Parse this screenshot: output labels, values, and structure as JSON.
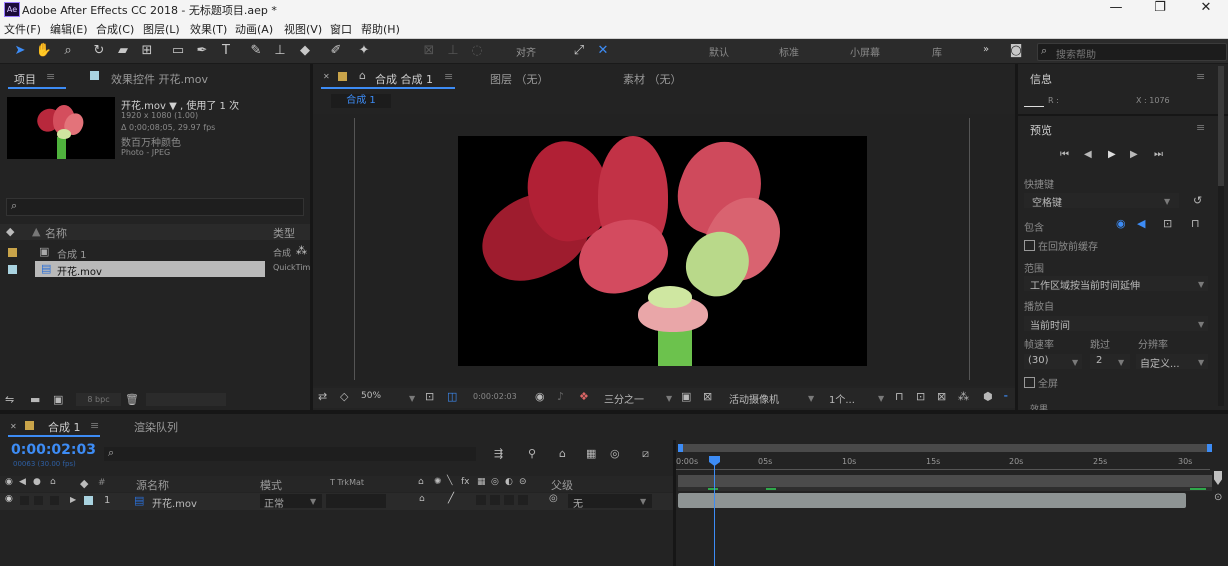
{
  "window": {
    "title": "Adobe After Effects CC 2018 - 无标题项目.aep *",
    "app_icon": "Ae",
    "minimize_icon": "—",
    "maximize_icon": "❐",
    "close_icon": "✕"
  },
  "menu": [
    "文件(F)",
    "编辑(E)",
    "合成(C)",
    "图层(L)",
    "效果(T)",
    "动画(A)",
    "视图(V)",
    "窗口",
    "帮助(H)"
  ],
  "toolbar": {
    "snap_label": "对齐",
    "workspaces": [
      "默认",
      "标准",
      "小屏幕",
      "库"
    ],
    "workspace_more": "»",
    "search_placeholder": "搜索帮助"
  },
  "project_panel": {
    "tab_project": "项目",
    "tab_effects": "效果控件 开花.mov",
    "selected_name": "开花.mov ▼ , 使用了 1 次",
    "info_line1": "1920 x 1080 (1.00)",
    "info_line2": "Δ 0;00;08;05, 29.97 fps",
    "info_line3": "数百万种颜色",
    "info_line4": "Photo - JPEG",
    "search_icon": "⌕",
    "col_name": "名称",
    "col_type": "类型",
    "items": [
      {
        "name": "合成 1",
        "type": "合成",
        "color": "#c9a44a"
      },
      {
        "name": "开花.mov",
        "type": "QuickTime",
        "color": "#a9d3e0"
      }
    ],
    "bpc": "8 bpc"
  },
  "composition_panel": {
    "tab_comp": "合成 合成 1",
    "tab_layer": "图层 （无）",
    "tab_footage": "素材 （无）",
    "breadcrumb": "合成 1",
    "zoom": "50%",
    "timecode": "0:00:02:03",
    "resolution": "三分之一",
    "camera": "活动摄像机",
    "views": "1个..."
  },
  "info_panel": {
    "title": "信息",
    "r_label": "R :",
    "x_label": "X : 1076"
  },
  "preview_panel": {
    "title": "预览",
    "shortcut_label": "快捷键",
    "shortcut_value": "空格键",
    "include_label": "包含",
    "cache_label": "在回放前缓存",
    "range_label": "范围",
    "range_value": "工作区域按当前时间延伸",
    "play_from_label": "播放自",
    "play_from_value": "当前时间",
    "fps_label": "帧速率",
    "skip_label": "跳过",
    "res_label": "分辨率",
    "fps_value": "(30)",
    "skip_value": "2",
    "res_value": "自定义...",
    "fullscreen_label": "全屏",
    "effects_label": "效果"
  },
  "timeline": {
    "tab_comp": "合成 1",
    "tab_render": "渲染队列",
    "current_time": "0:00:02:03",
    "frame_info": "00063 (30.00 fps)",
    "search_icon": "⌕",
    "col_source": "源名称",
    "col_mode": "模式",
    "col_trkmat": "T TrkMat",
    "col_parent": "父级",
    "layer_num": "1",
    "layer_name": "开花.mov",
    "layer_mode": "正常",
    "layer_parent": "无",
    "ruler_ticks": [
      "0:00s",
      "05s",
      "10s",
      "15s",
      "20s",
      "25s",
      "30s"
    ]
  },
  "colors": {
    "accent": "#3d8cf5",
    "panel_bg": "#232323",
    "timecode": "#3d8cf5"
  }
}
